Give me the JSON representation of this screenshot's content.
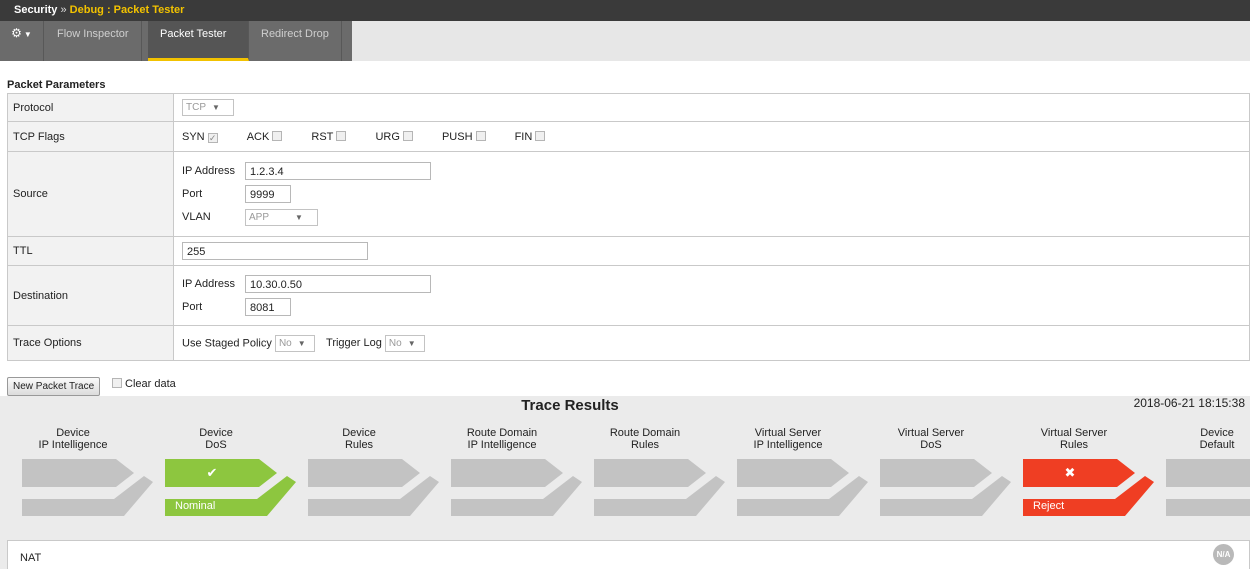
{
  "header": {
    "breadcrumb_root": "Security",
    "breadcrumb_sep": "»",
    "breadcrumb_active": "Debug : Packet Tester"
  },
  "tabs": [
    {
      "label": "Flow Inspector",
      "active": false
    },
    {
      "label": "Packet Tester",
      "active": true
    },
    {
      "label": "Redirect Drop",
      "active": false
    }
  ],
  "params": {
    "section_title": "Packet Parameters",
    "protocol": {
      "label": "Protocol",
      "value": "TCP"
    },
    "tcp_flags": {
      "label": "TCP Flags",
      "flags": [
        {
          "name": "SYN",
          "checked": true
        },
        {
          "name": "ACK",
          "checked": false
        },
        {
          "name": "RST",
          "checked": false
        },
        {
          "name": "URG",
          "checked": false
        },
        {
          "name": "PUSH",
          "checked": false
        },
        {
          "name": "FIN",
          "checked": false
        }
      ]
    },
    "source": {
      "label": "Source",
      "ip_label": "IP Address",
      "ip": "1.2.3.4",
      "port_label": "Port",
      "port": "9999",
      "vlan_label": "VLAN",
      "vlan": "APP"
    },
    "ttl": {
      "label": "TTL",
      "value": "255"
    },
    "destination": {
      "label": "Destination",
      "ip_label": "IP Address",
      "ip": "10.30.0.50",
      "port_label": "Port",
      "port": "8081"
    },
    "trace_options": {
      "label": "Trace Options",
      "staged_label": "Use Staged Policy",
      "staged_value": "No",
      "trigger_label": "Trigger Log",
      "trigger_value": "No"
    }
  },
  "controls": {
    "new_trace_label": "New Packet Trace",
    "clear_label": "Clear data"
  },
  "results": {
    "title": "Trace Results",
    "timestamp": "2018-06-21 18:15:38",
    "stages": [
      {
        "line1": "Device",
        "line2": "IP Intelligence",
        "state": "none",
        "status": ""
      },
      {
        "line1": "Device",
        "line2": "DoS",
        "state": "pass",
        "status": "Nominal",
        "mark": "✔"
      },
      {
        "line1": "Device",
        "line2": "Rules",
        "state": "none",
        "status": ""
      },
      {
        "line1": "Route Domain",
        "line2": "IP Intelligence",
        "state": "none",
        "status": ""
      },
      {
        "line1": "Route Domain",
        "line2": "Rules",
        "state": "none",
        "status": ""
      },
      {
        "line1": "Virtual Server",
        "line2": "IP Intelligence",
        "state": "none",
        "status": ""
      },
      {
        "line1": "Virtual Server",
        "line2": "DoS",
        "state": "none",
        "status": ""
      },
      {
        "line1": "Virtual Server",
        "line2": "Rules",
        "state": "fail",
        "status": "Reject",
        "mark": "✖"
      },
      {
        "line1": "Device",
        "line2": "Default",
        "state": "none",
        "status": ""
      }
    ],
    "nat_label": "NAT",
    "nat_badge": "N/A"
  },
  "colors": {
    "pass": "#8dc63f",
    "fail": "#ef3e23",
    "idle": "#c3c3c3",
    "accent": "#f2c200"
  }
}
